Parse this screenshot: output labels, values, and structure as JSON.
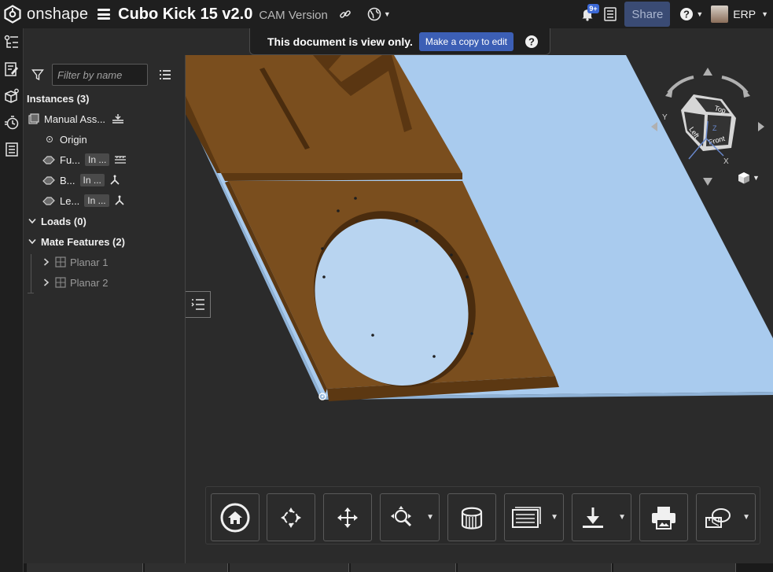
{
  "topbar": {
    "brand": "onshape",
    "doc_title": "Cubo Kick 15 v2.0",
    "version_label": "CAM Version",
    "notification_count": "9+",
    "share_label": "Share",
    "user_name": "ERP",
    "icons": [
      "onshape-logo-icon",
      "hamburger-menu-icon",
      "link-icon",
      "globe-icon",
      "bell-icon",
      "tasks-icon",
      "help-icon"
    ]
  },
  "notice": {
    "text": "This document is view only.",
    "button_label": "Make a copy to edit"
  },
  "rail": {
    "icons": [
      "instances-tree-icon",
      "feature-list-icon",
      "parts-cube-icon",
      "animation-icon",
      "bill-of-materials-icon"
    ]
  },
  "panel": {
    "filter_placeholder": "Filter by name",
    "instances_header": "Instances (3)",
    "items": [
      {
        "label": "Manual Ass...",
        "icon": "assembly-icon",
        "status_icon": "fixed-ground-icon"
      },
      {
        "label": "Origin",
        "icon": "origin-icon"
      },
      {
        "label": "Fu...",
        "pill": "In ...",
        "icon": "part-studio-icon",
        "status_icon": "fixed-icon"
      },
      {
        "label": "B...",
        "pill": "In ...",
        "icon": "part-studio-icon",
        "status_icon": "mate-icon"
      },
      {
        "label": "Le...",
        "pill": "In ...",
        "icon": "part-studio-icon",
        "status_icon": "mate-icon"
      }
    ],
    "loads_header": "Loads (0)",
    "mates_header": "Mate Features (2)",
    "mates": [
      {
        "label": "Planar 1"
      },
      {
        "label": "Planar 2"
      }
    ]
  },
  "viewcube": {
    "faces": {
      "top": "Top",
      "front": "Front",
      "left": "Left"
    },
    "axes": {
      "x": "X",
      "y": "Y",
      "z": "Z"
    }
  },
  "toolbar": {
    "buttons": [
      "home-view-icon",
      "rotate-icon",
      "pan-icon",
      "zoom-icon",
      "render-mode-icon",
      "named-views-icon",
      "download-icon",
      "print-icon",
      "measure-icon"
    ]
  },
  "colors": {
    "wood": "#7a4e1e",
    "wood_edge": "#5c3812",
    "floor": "#a8c8ea",
    "accent": "#3c5fb5",
    "background": "#2b2b2b"
  }
}
